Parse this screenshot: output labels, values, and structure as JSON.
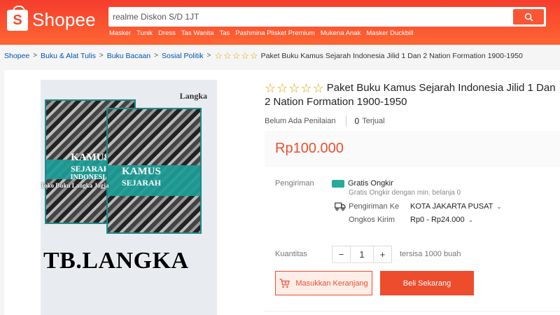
{
  "header": {
    "logo_text": "Shopee",
    "search_value": "realme Diskon S/D 1JT",
    "hint_links": [
      "Masker",
      "Tunik",
      "Dress",
      "Tas Wanita",
      "Tas",
      "Pashmina Plisket Premium",
      "Mukena Anak",
      "Masker Duckbill"
    ]
  },
  "breadcrumb": {
    "items": [
      "Shopee",
      "Buku & Alat Tulis",
      "Buku Bacaan",
      "Sosial Politik"
    ],
    "current": "Paket Buku Kamus Sejarah Indonesia Jilid 1 Dan 2 Nation Formation 1900-1950",
    "separator": ">"
  },
  "product": {
    "title": "Paket Buku Kamus Sejarah Indonesia Jilid 1 Dan 2 Nation Formation 1900-1950",
    "star_count": 5,
    "rating_text": "Belum Ada Penilaian",
    "sold_count": "0",
    "sold_label": "Terjual",
    "price": "Rp100.000",
    "image": {
      "corner_text": "Langka",
      "book_title_line1": "KAMUS",
      "book_title_line2": "SEJARAH",
      "book_title_line3": "INDONESIA",
      "overlay_watermark": "Toko Buku Langka Jogja",
      "shop_watermark": "TB.LANGKA"
    }
  },
  "shipping": {
    "label": "Pengiriman",
    "free_title": "Gratis Ongkir",
    "free_sub": "Gratis Ongkir dengan min. belanja 0",
    "ship_to_label": "Pengiriman Ke",
    "ship_to_value": "KOTA JAKARTA PUSAT",
    "cost_label": "Ongkos Kirim",
    "cost_value": "Rp0 - Rp24.000"
  },
  "quantity": {
    "label": "Kuantitas",
    "minus": "−",
    "value": "1",
    "plus": "+",
    "stock_text": "tersisa 1000 buah"
  },
  "actions": {
    "cart_label": "Masukkan Keranjang",
    "buy_label": "Beli Sekarang"
  },
  "colors": {
    "brand": "#ee4d2d",
    "link": "#0055aa",
    "star": "#d8a500",
    "free_ship": "#26aa99"
  }
}
